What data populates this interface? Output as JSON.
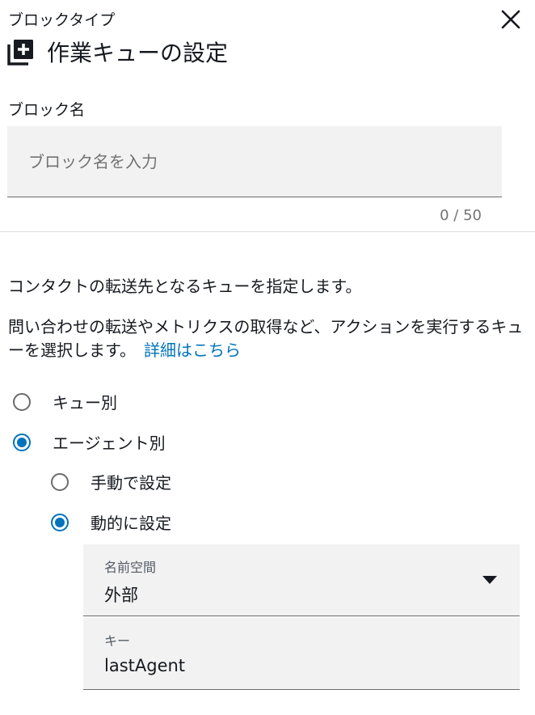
{
  "header": {
    "block_type_label": "ブロックタイプ",
    "title": "作業キューの設定",
    "close_icon": "close-icon",
    "title_icon": "add-box-stack-icon"
  },
  "block_name": {
    "label": "ブロック名",
    "placeholder": "ブロック名を入力",
    "value": "",
    "counter": "0 / 50"
  },
  "description": {
    "line1": "コンタクトの転送先となるキューを指定します。",
    "line2": "問い合わせの転送やメトリクスの取得など、アクションを実行するキューを選択します。",
    "link": "詳細はこちら"
  },
  "options": {
    "by_queue": {
      "label": "キュー別",
      "selected": false
    },
    "by_agent": {
      "label": "エージェント別",
      "selected": true
    },
    "manual": {
      "label": "手動で設定",
      "selected": false
    },
    "dynamic": {
      "label": "動的に設定",
      "selected": true
    }
  },
  "namespace": {
    "label": "名前空間",
    "value": "外部"
  },
  "key": {
    "label": "キー",
    "value": "lastAgent"
  },
  "colors": {
    "accent": "#0073bb",
    "text": "#16191f",
    "field_bg": "#f2f2f2"
  }
}
